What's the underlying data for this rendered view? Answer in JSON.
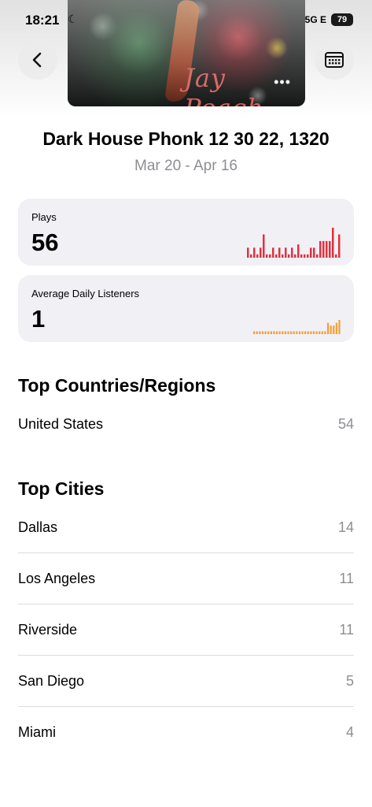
{
  "status_bar": {
    "time": "18:21",
    "network": "5G E",
    "battery": "79"
  },
  "artwork": {
    "text": "Jay Peach",
    "menu_dots": "•••"
  },
  "header": {
    "title": "Dark House Phonk 12 30 22, 1320",
    "date_range": "Mar 20 - Apr 16"
  },
  "plays": {
    "label": "Plays",
    "value": "56",
    "color": "#e0303e",
    "spark": [
      3,
      1,
      3,
      1,
      3,
      7,
      1,
      1,
      3,
      1,
      3,
      1,
      3,
      1,
      3,
      1,
      4,
      1,
      1,
      1,
      3,
      3,
      1,
      5,
      5,
      5,
      5,
      9,
      1,
      7
    ]
  },
  "listeners": {
    "label": "Average Daily Listeners",
    "value": "1",
    "color": "#f5a03a",
    "spark": [
      1,
      1,
      1,
      1,
      1,
      1,
      1,
      1,
      1,
      1,
      1,
      1,
      1,
      1,
      1,
      1,
      1,
      1,
      1,
      1,
      1,
      1,
      1,
      1,
      1,
      1,
      4,
      3,
      3,
      4,
      5
    ]
  },
  "countries": {
    "heading": "Top Countries/Regions",
    "items": [
      {
        "name": "United States",
        "count": "54"
      }
    ]
  },
  "cities": {
    "heading": "Top Cities",
    "items": [
      {
        "name": "Dallas",
        "count": "14"
      },
      {
        "name": "Los Angeles",
        "count": "11"
      },
      {
        "name": "Riverside",
        "count": "11"
      },
      {
        "name": "San Diego",
        "count": "5"
      },
      {
        "name": "Miami",
        "count": "4"
      }
    ]
  },
  "icons": {
    "back": "chevron-left-icon",
    "calendar": "calendar-icon",
    "moon": "moon-icon"
  }
}
